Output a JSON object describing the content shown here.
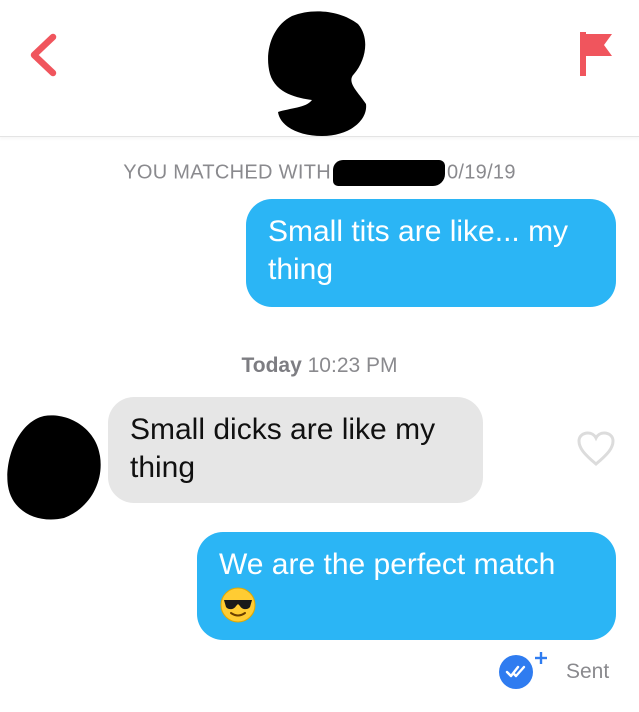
{
  "header": {
    "back_icon": "chevron-left-icon",
    "flag_icon": "flag-icon",
    "accent_color": "#f0555d"
  },
  "match_line": {
    "prefix": "YOU MATCHED WITH",
    "suffix": "0/19/19"
  },
  "messages": [
    {
      "direction": "sent",
      "text": "Small tits are like... my thing"
    },
    {
      "direction": "received",
      "text": "Small dicks are like my thing"
    },
    {
      "direction": "sent",
      "text": "We are the perfect match",
      "emoji": "sunglasses-emoji"
    }
  ],
  "timestamp": {
    "day": "Today",
    "time": "10:23 PM"
  },
  "status": {
    "label": "Sent",
    "read_icon": "double-check-icon"
  },
  "colors": {
    "sent_bubble": "#2bb5f5",
    "received_bubble": "#e6e6e6",
    "meta_text": "#8a8a8e"
  }
}
